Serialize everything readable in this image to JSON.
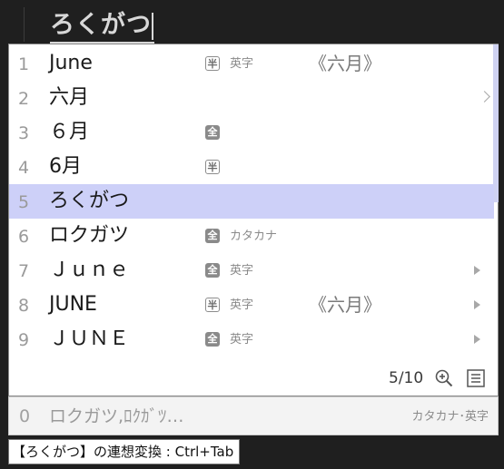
{
  "composition": {
    "text": "ろくがつ"
  },
  "candidates": [
    {
      "num": "1",
      "text": "June",
      "badge": "半",
      "badge_style": "half",
      "type": "英字",
      "annotation": "《六月》",
      "arrow": ""
    },
    {
      "num": "2",
      "text": "六月",
      "badge": "",
      "badge_style": "",
      "type": "",
      "annotation": "",
      "arrow": "open"
    },
    {
      "num": "3",
      "text": "６月",
      "badge": "全",
      "badge_style": "full",
      "type": "",
      "annotation": "",
      "arrow": ""
    },
    {
      "num": "4",
      "text": "6月",
      "badge": "半",
      "badge_style": "half",
      "type": "",
      "annotation": "",
      "arrow": ""
    },
    {
      "num": "5",
      "text": "ろくがつ",
      "badge": "",
      "badge_style": "",
      "type": "",
      "annotation": "",
      "arrow": "",
      "selected": true
    },
    {
      "num": "6",
      "text": "ロクガツ",
      "badge": "全",
      "badge_style": "full",
      "type": "カタカナ",
      "annotation": "",
      "arrow": ""
    },
    {
      "num": "7",
      "text": "Ｊｕｎｅ",
      "badge": "全",
      "badge_style": "full",
      "type": "英字",
      "annotation": "",
      "arrow": "solid"
    },
    {
      "num": "8",
      "text": "JUNE",
      "badge": "半",
      "badge_style": "half",
      "type": "英字",
      "annotation": "《六月》",
      "arrow": "solid"
    },
    {
      "num": "9",
      "text": "ＪＵＮＥ",
      "badge": "全",
      "badge_style": "full",
      "type": "英字",
      "annotation": "",
      "arrow": "solid"
    }
  ],
  "footer": {
    "page": "5/10",
    "zoom_icon": "zoom-in-icon",
    "list_icon": "list-icon"
  },
  "prediction": {
    "num": "0",
    "text": "ロクガツ,ﾛｸｶﾞﾂ…",
    "type": "カタカナ･英字"
  },
  "hint": {
    "text": "【ろくがつ】の連想変換 : Ctrl+Tab"
  },
  "colors": {
    "selected_row": "#cdd0f8",
    "background_dark": "#1f1f1f",
    "window_bg": "#ffffff"
  }
}
